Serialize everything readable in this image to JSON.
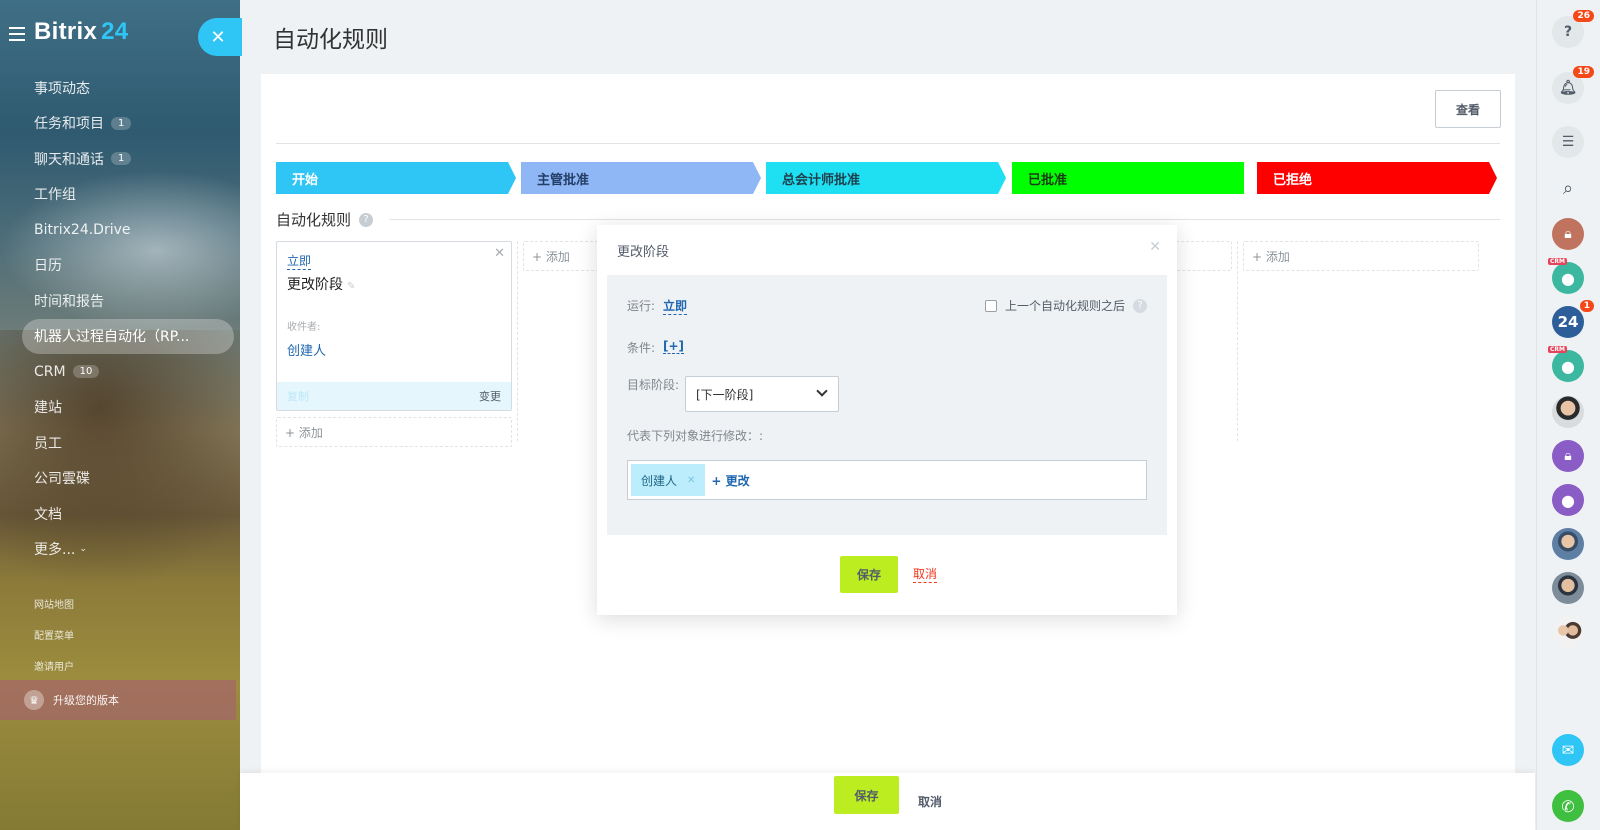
{
  "sidebar": {
    "logo_text": "Bitrix",
    "logo_num": "24",
    "items": [
      {
        "label": "事项动态",
        "count": ""
      },
      {
        "label": "任务和项目",
        "count": "1"
      },
      {
        "label": "聊天和通话",
        "count": "1"
      },
      {
        "label": "工作组",
        "count": ""
      },
      {
        "label": "Bitrix24.Drive",
        "count": ""
      },
      {
        "label": "日历",
        "count": ""
      },
      {
        "label": "时间和报告",
        "count": ""
      },
      {
        "label": "机器人过程自动化（RP...",
        "count": ""
      },
      {
        "label": "CRM",
        "count": "10"
      },
      {
        "label": "建站",
        "count": ""
      },
      {
        "label": "员工",
        "count": ""
      },
      {
        "label": "公司雲碟",
        "count": ""
      },
      {
        "label": "文档",
        "count": ""
      },
      {
        "label": "更多...",
        "count": ""
      }
    ],
    "small_links": [
      "网站地图",
      "配置菜单",
      "邀请用户"
    ],
    "upgrade_label": "升级您的版本"
  },
  "header": {
    "title": "自动化规则",
    "view_button": "查看"
  },
  "stages": [
    {
      "label": "开始",
      "color": "#2fc6f6"
    },
    {
      "label": "主管批准",
      "color": "#8fb6f5"
    },
    {
      "label": "总会计师批准",
      "color": "#1ee0f2"
    },
    {
      "label": "已批准",
      "color": "#00ff00"
    },
    {
      "label": "已拒绝",
      "color": "#ff0000"
    }
  ],
  "automation": {
    "section_title": "自动化规则",
    "add_label": "+ 添加",
    "robot_card": {
      "when": "立即",
      "title": "更改阶段",
      "recipient_label": "收件者:",
      "recipient": "创建人",
      "copy_label": "复制",
      "edit_label": "变更"
    }
  },
  "modal": {
    "title": "更改阶段",
    "run_label": "运行:",
    "run_value": "立即",
    "after_previous_label": "上一个自动化规则之后",
    "condition_label": "条件:",
    "condition_value": "[+]",
    "target_label": "目标阶段:",
    "target_value": "[下一阶段]",
    "modify_on_behalf_label": "代表下列对象进行修改：:",
    "user_chip": "创建人",
    "add_user_label": "+ 更改",
    "save_label": "保存",
    "cancel_label": "取消"
  },
  "footer": {
    "save_label": "保存",
    "cancel_label": "取消"
  },
  "right_panel": {
    "help_badge": "26",
    "notify_badge": "19",
    "b24_label": "24",
    "b24_badge": "1",
    "crm_tag": "CRM"
  }
}
